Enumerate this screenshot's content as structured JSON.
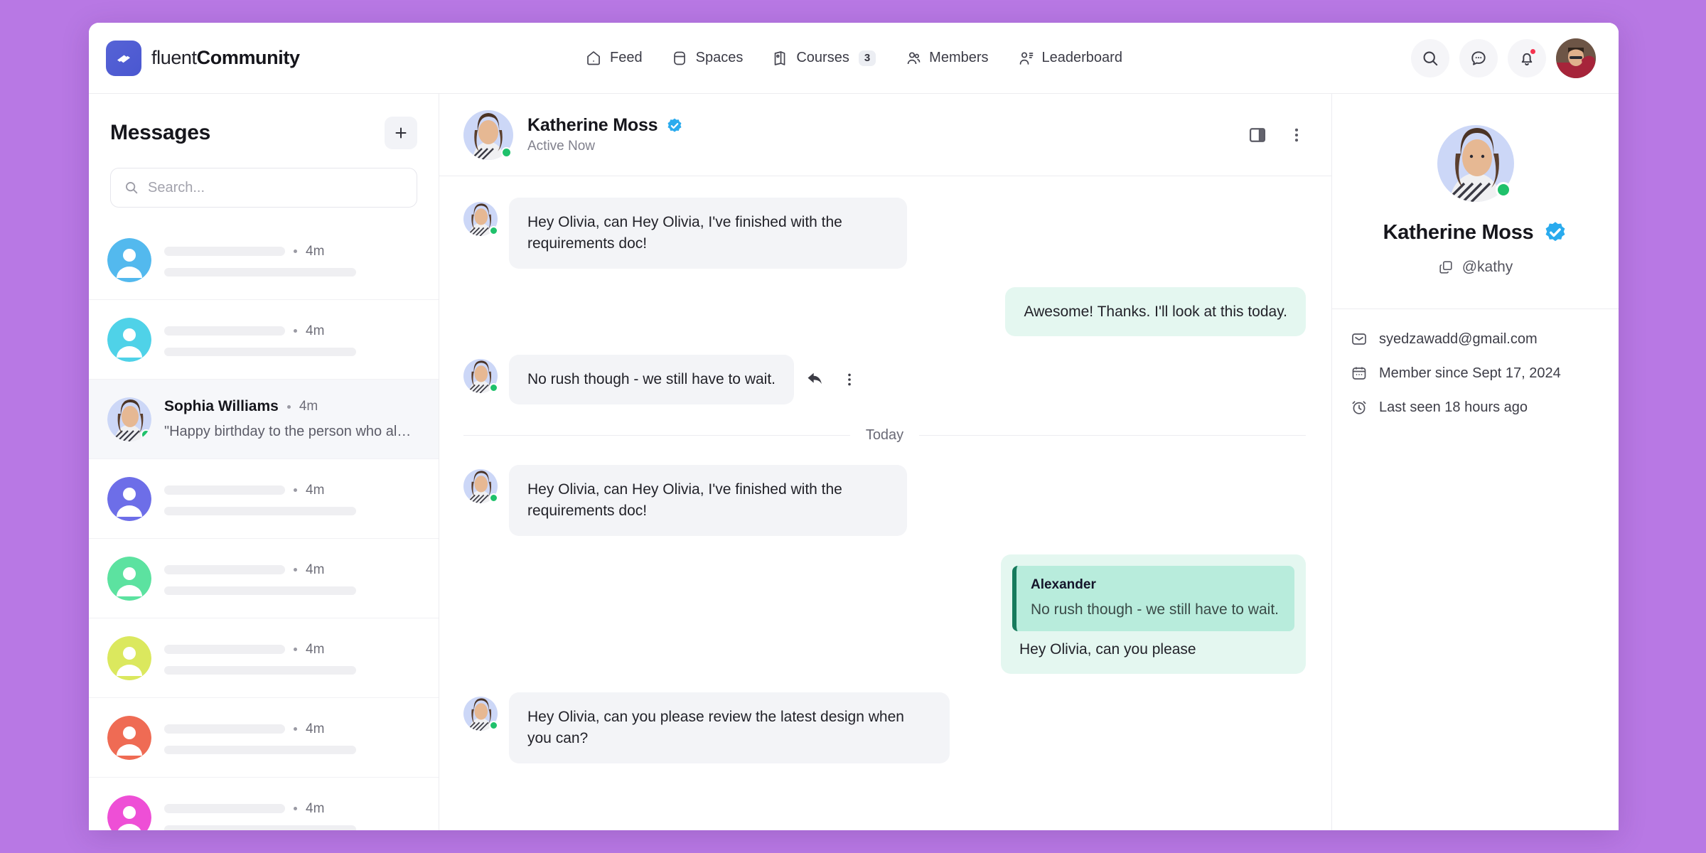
{
  "brand": {
    "light": "fluent",
    "bold": "Community",
    "logo_icon": "fluent-logo-icon"
  },
  "nav": {
    "items": [
      {
        "label": "Feed",
        "icon": "home-icon",
        "badge": null
      },
      {
        "label": "Spaces",
        "icon": "spaces-icon",
        "badge": null
      },
      {
        "label": "Courses",
        "icon": "courses-icon",
        "badge": "3"
      },
      {
        "label": "Members",
        "icon": "members-icon",
        "badge": null
      },
      {
        "label": "Leaderboard",
        "icon": "leaderboard-icon",
        "badge": null
      }
    ]
  },
  "topbar_actions": {
    "search_icon": "search-icon",
    "messages_icon": "chat-bubble-icon",
    "notifications_icon": "bell-icon",
    "avatar_name": "user-avatar"
  },
  "messages_pane": {
    "title": "Messages",
    "new_message_label": "+",
    "search": {
      "placeholder": "Search...",
      "value": ""
    },
    "conversations": [
      {
        "name": "",
        "preview": "",
        "time": "4m",
        "avatar_color": "#53b9ee",
        "skeleton": true,
        "online": false,
        "active": false
      },
      {
        "name": "",
        "preview": "",
        "time": "4m",
        "avatar_color": "#4fd2e8",
        "skeleton": true,
        "online": false,
        "active": false
      },
      {
        "name": "Sophia Williams",
        "preview": "\"Happy birthday to the person who alwa...",
        "time": "4m",
        "avatar_color": "#d7e0fb",
        "skeleton": false,
        "online": true,
        "active": true
      },
      {
        "name": "",
        "preview": "",
        "time": "4m",
        "avatar_color": "#6d6ee8",
        "skeleton": true,
        "online": false,
        "active": false
      },
      {
        "name": "",
        "preview": "",
        "time": "4m",
        "avatar_color": "#5ce2a0",
        "skeleton": true,
        "online": false,
        "active": false
      },
      {
        "name": "",
        "preview": "",
        "time": "4m",
        "avatar_color": "#dbe85e",
        "skeleton": true,
        "online": false,
        "active": false
      },
      {
        "name": "",
        "preview": "",
        "time": "4m",
        "avatar_color": "#ef6b54",
        "skeleton": true,
        "online": false,
        "active": false
      },
      {
        "name": "",
        "preview": "",
        "time": "4m",
        "avatar_color": "#ee4fd6",
        "skeleton": true,
        "online": false,
        "active": false
      }
    ]
  },
  "chat": {
    "header": {
      "name": "Katherine Moss",
      "status": "Active Now",
      "verified": true,
      "panel_toggle_icon": "side-panel-icon",
      "more_icon": "more-vertical-icon"
    },
    "day_separator": "Today",
    "messages": [
      {
        "id": "m1",
        "dir": "in",
        "text": "Hey Olivia, can Hey Olivia, I've finished with the requirements doc!",
        "avatar": true,
        "hover_actions": false
      },
      {
        "id": "m2",
        "dir": "out",
        "text": "Awesome! Thanks. I'll look at this today.",
        "avatar": false,
        "hover_actions": false
      },
      {
        "id": "m3",
        "dir": "in",
        "text": "No rush though - we still have to wait.",
        "avatar": true,
        "hover_actions": true
      },
      {
        "id": "m4",
        "dir": "in",
        "text": "Hey Olivia, can Hey Olivia, I've finished with the requirements doc!",
        "avatar": true,
        "hover_actions": false
      },
      {
        "id": "m5",
        "dir": "out",
        "quote_author": "Alexander",
        "quote_text": "No rush though - we still have to wait.",
        "text": "Hey Olivia, can you please",
        "avatar": false,
        "hover_actions": false
      },
      {
        "id": "m6",
        "dir": "in",
        "text": "Hey Olivia, can you please review the latest design when you can?",
        "avatar": true,
        "hover_actions": false
      }
    ],
    "hover_action_icons": {
      "reply": "reply-arrow-icon",
      "more": "more-vertical-icon"
    }
  },
  "profile": {
    "name": "Katherine Moss",
    "verified": true,
    "handle": "@kathy",
    "copy_icon": "copy-icon",
    "online": true,
    "meta": [
      {
        "icon": "mail-icon",
        "text": "syedzawadd@gmail.com"
      },
      {
        "icon": "calendar-icon",
        "text": "Member since Sept 17, 2024"
      },
      {
        "icon": "clock-icon",
        "text": "Last seen 18 hours ago"
      }
    ]
  },
  "colors": {
    "page_background": "#b878e4",
    "brand_purple": "#4a57d0",
    "online_green": "#1fc16b",
    "outgoing_bubble": "#e4f7f0",
    "incoming_bubble": "#f3f4f7",
    "verified_blue": "#2aabee",
    "notification_red": "#f5334f",
    "quote_accent": "#167a5c"
  }
}
